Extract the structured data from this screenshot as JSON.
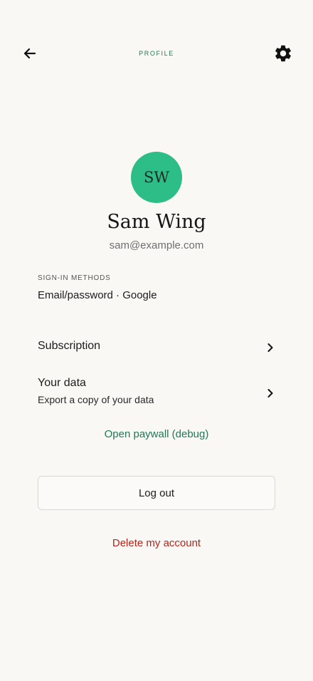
{
  "header": {
    "title": "PROFILE",
    "back_icon": "arrow-left-icon",
    "settings_icon": "gear-icon"
  },
  "profile": {
    "initials": "SW",
    "name": "Sam Wing",
    "email": "sam@example.com",
    "avatar_color": "#2dbd86"
  },
  "sign_in": {
    "label": "SIGN-IN METHODS",
    "value": "Email/password · Google"
  },
  "rows": [
    {
      "title": "Subscription",
      "subtitle": ""
    },
    {
      "title": "Your data",
      "subtitle": "Export a copy of your data"
    }
  ],
  "actions": {
    "debug_link": "Open paywall (debug)",
    "logout": "Log out",
    "delete_account": "Delete my account"
  },
  "colors": {
    "background": "#f9f8f5",
    "accent": "#1f7a55",
    "danger": "#b3261e"
  }
}
